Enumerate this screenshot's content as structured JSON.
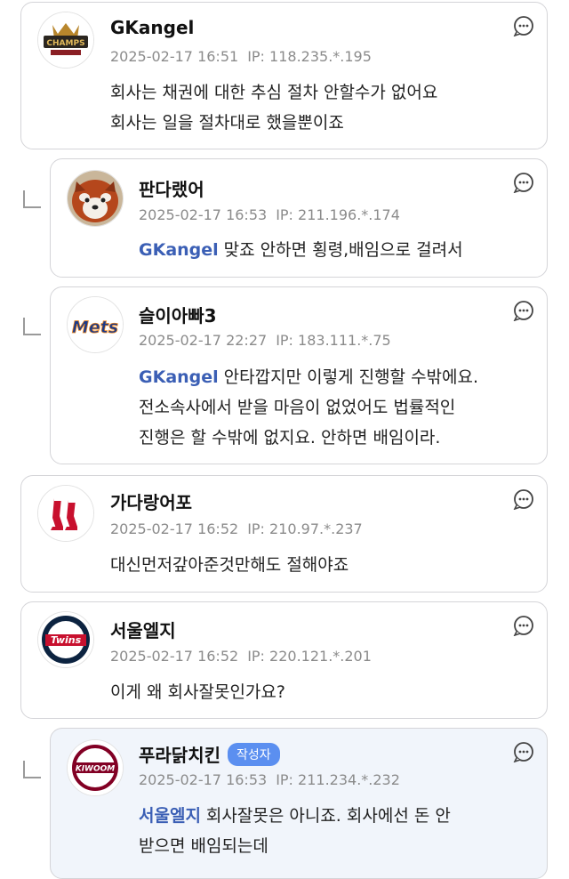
{
  "comments": [
    {
      "username": "GKangel",
      "datetime": "2025-02-17 16:51",
      "ip": "IP: 118.235.*.195",
      "lines": [
        "회사는 채권에 대한 추심 절차 안할수가 없어요",
        "회사는 일을 절차대로 했을뿐이죠"
      ],
      "avatar_icon": "champions-logo-icon"
    },
    {
      "username": "판다랬어",
      "datetime": "2025-02-17 16:53",
      "ip": "IP: 211.196.*.174",
      "mention": "GKangel",
      "lines": [
        "맞죠 안하면 횡령,배임으로 걸려서"
      ],
      "avatar_icon": "red-panda-icon"
    },
    {
      "username": "슬이아빠3",
      "datetime": "2025-02-17 22:27",
      "ip": "IP: 183.111.*.75",
      "mention": "GKangel",
      "lines": [
        "안타깝지만 이렇게 진행할 수밖에요.",
        "전소속사에서 받을 마음이 없었어도 법률적인",
        "진행은 할 수밖에 없지요. 안하면 배임이라."
      ],
      "avatar_icon": "mets-logo-icon",
      "avatar_text": "Mets"
    },
    {
      "username": "가다랑어포",
      "datetime": "2025-02-17 16:52",
      "ip": "IP: 210.97.*.237",
      "lines": [
        "대신먼저갚아준것만해도 절해야죠"
      ],
      "avatar_icon": "red-sox-logo-icon"
    },
    {
      "username": "서울엘지",
      "datetime": "2025-02-17 16:52",
      "ip": "IP: 220.121.*.201",
      "lines": [
        "이게 왜 회사잘못인가요?"
      ],
      "avatar_icon": "twins-logo-icon",
      "avatar_text": "Twins"
    },
    {
      "username": "푸라닭치킨",
      "badge": "작성자",
      "datetime": "2025-02-17 16:53",
      "ip": "IP: 211.234.*.232",
      "mention": "서울엘지",
      "lines": [
        "회사잘못은 아니죠. 회사에선 돈 안",
        "받으면 배임되는데"
      ],
      "avatar_icon": "kiwoom-logo-icon",
      "avatar_text": "KIWOOM"
    }
  ],
  "colors": {
    "mention": "#3b5fb5",
    "badge": "#5b8ff0",
    "author_card_bg": "#f1f5fb",
    "meta": "#8b8b8b"
  },
  "icons": {
    "more": "speech-bubble-more-icon",
    "reply": "reply-arrow-icon"
  }
}
